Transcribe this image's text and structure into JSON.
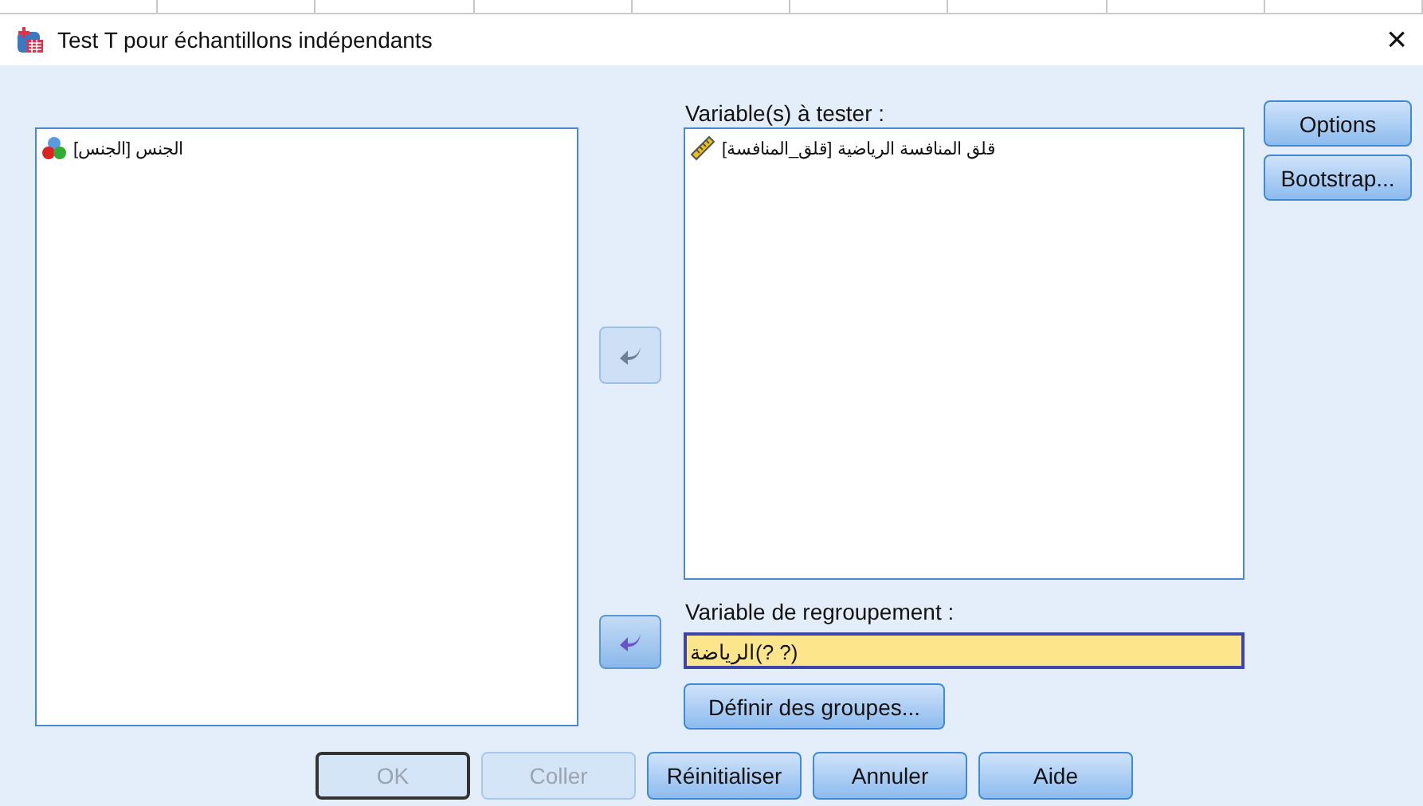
{
  "window": {
    "title": "Test T pour échantillons indépendants",
    "close": "×"
  },
  "source_list": {
    "items": [
      {
        "label": "الجنس [الجنس]",
        "kind": "nominal"
      }
    ]
  },
  "move_buttons": [
    {
      "disabled": true
    },
    {
      "disabled": false
    }
  ],
  "test_variables": {
    "label": "Variable(s) à tester :",
    "items": [
      {
        "label": "قلق المنافسة الرياضية [قلق_المنافسة]",
        "kind": "scale"
      }
    ]
  },
  "grouping": {
    "label": "Variable de regroupement :",
    "value": "الرياضة(? ?)",
    "define_button": "Définir des groupes..."
  },
  "side_buttons": [
    {
      "label": "Options",
      "disabled": false
    },
    {
      "label": "Bootstrap...",
      "disabled": false
    }
  ],
  "footer_buttons": [
    {
      "label": "OK",
      "disabled": true
    },
    {
      "label": "Coller",
      "disabled": true
    },
    {
      "label": "Réinitialiser",
      "disabled": false
    },
    {
      "label": "Annuler",
      "disabled": false
    },
    {
      "label": "Aide",
      "disabled": false
    }
  ]
}
